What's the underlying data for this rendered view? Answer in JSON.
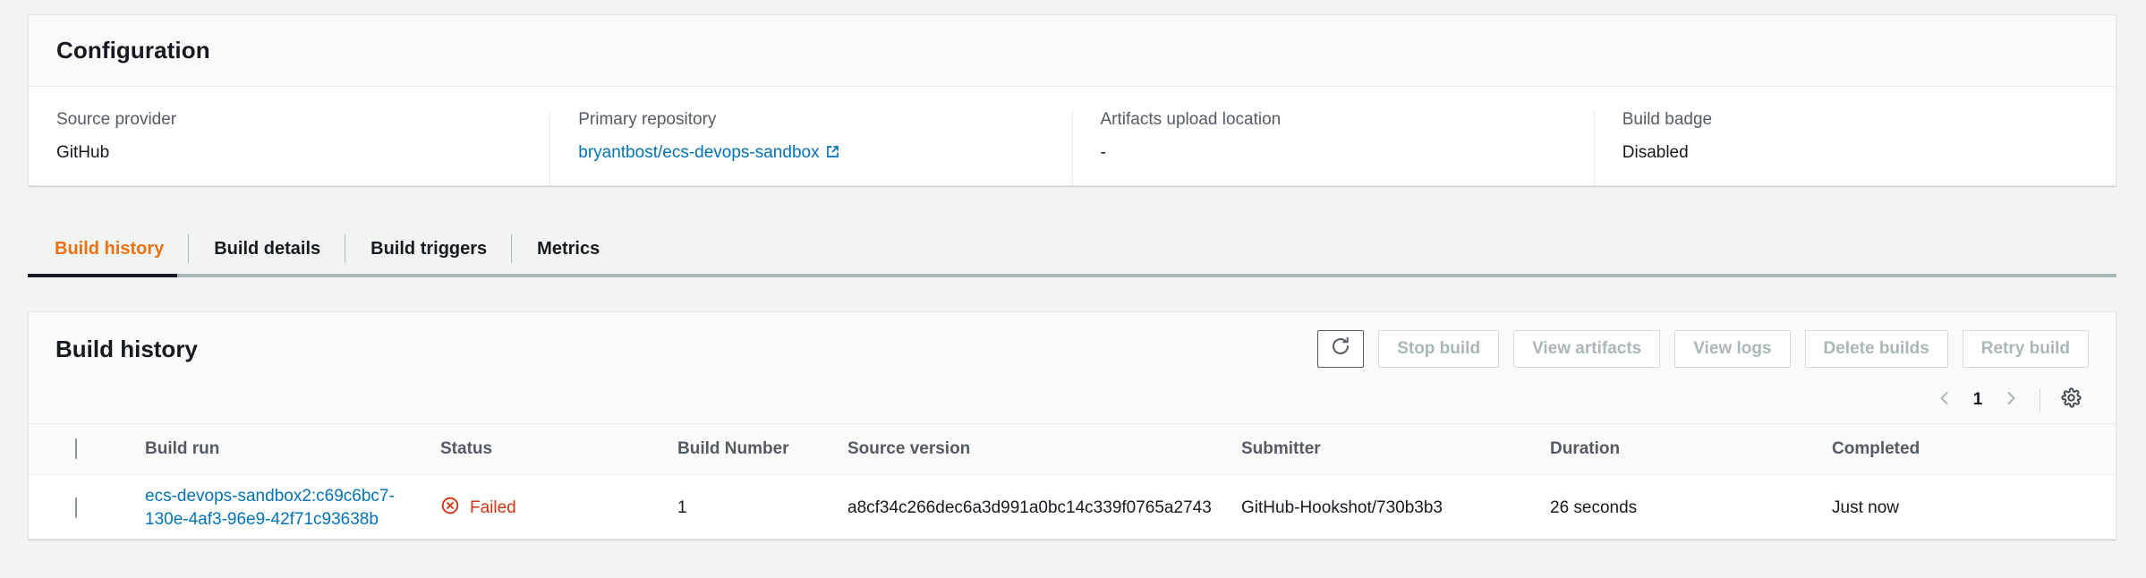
{
  "configuration": {
    "title": "Configuration",
    "fields": [
      {
        "label": "Source provider",
        "value": "GitHub",
        "is_link": false
      },
      {
        "label": "Primary repository",
        "value": "bryantbost/ecs-devops-sandbox",
        "is_link": true
      },
      {
        "label": "Artifacts upload location",
        "value": "-",
        "is_link": false
      },
      {
        "label": "Build badge",
        "value": "Disabled",
        "is_link": false
      }
    ]
  },
  "tabs": {
    "items": [
      {
        "label": "Build history",
        "active": true
      },
      {
        "label": "Build details",
        "active": false
      },
      {
        "label": "Build triggers",
        "active": false
      },
      {
        "label": "Metrics",
        "active": false
      }
    ],
    "active_color": "#ec7211"
  },
  "build_history": {
    "title": "Build history",
    "toolbar": {
      "refresh_icon": "refresh-icon",
      "buttons": [
        {
          "label": "Stop build",
          "disabled": true
        },
        {
          "label": "View artifacts",
          "disabled": true
        },
        {
          "label": "View logs",
          "disabled": true
        },
        {
          "label": "Delete builds",
          "disabled": true
        },
        {
          "label": "Retry build",
          "disabled": true
        }
      ]
    },
    "pagination": {
      "prev_icon": "chevron-left-icon",
      "page": "1",
      "next_icon": "chevron-right-icon",
      "settings_icon": "gear-icon"
    },
    "table": {
      "columns": [
        "Build run",
        "Status",
        "Build Number",
        "Source version",
        "Submitter",
        "Duration",
        "Completed"
      ],
      "rows": [
        {
          "build_run": "ecs-devops-sandbox2:c69c6bc7-130e-4af3-96e9-42f71c93638b",
          "status": "Failed",
          "status_icon": "error-circle-icon",
          "status_color": "#d13212",
          "build_number": "1",
          "source_version": "a8cf34c266dec6a3d991a0bc14c339f0765a2743",
          "submitter": "GitHub-Hookshot/730b3b3",
          "duration": "26 seconds",
          "completed": "Just now"
        }
      ]
    }
  }
}
